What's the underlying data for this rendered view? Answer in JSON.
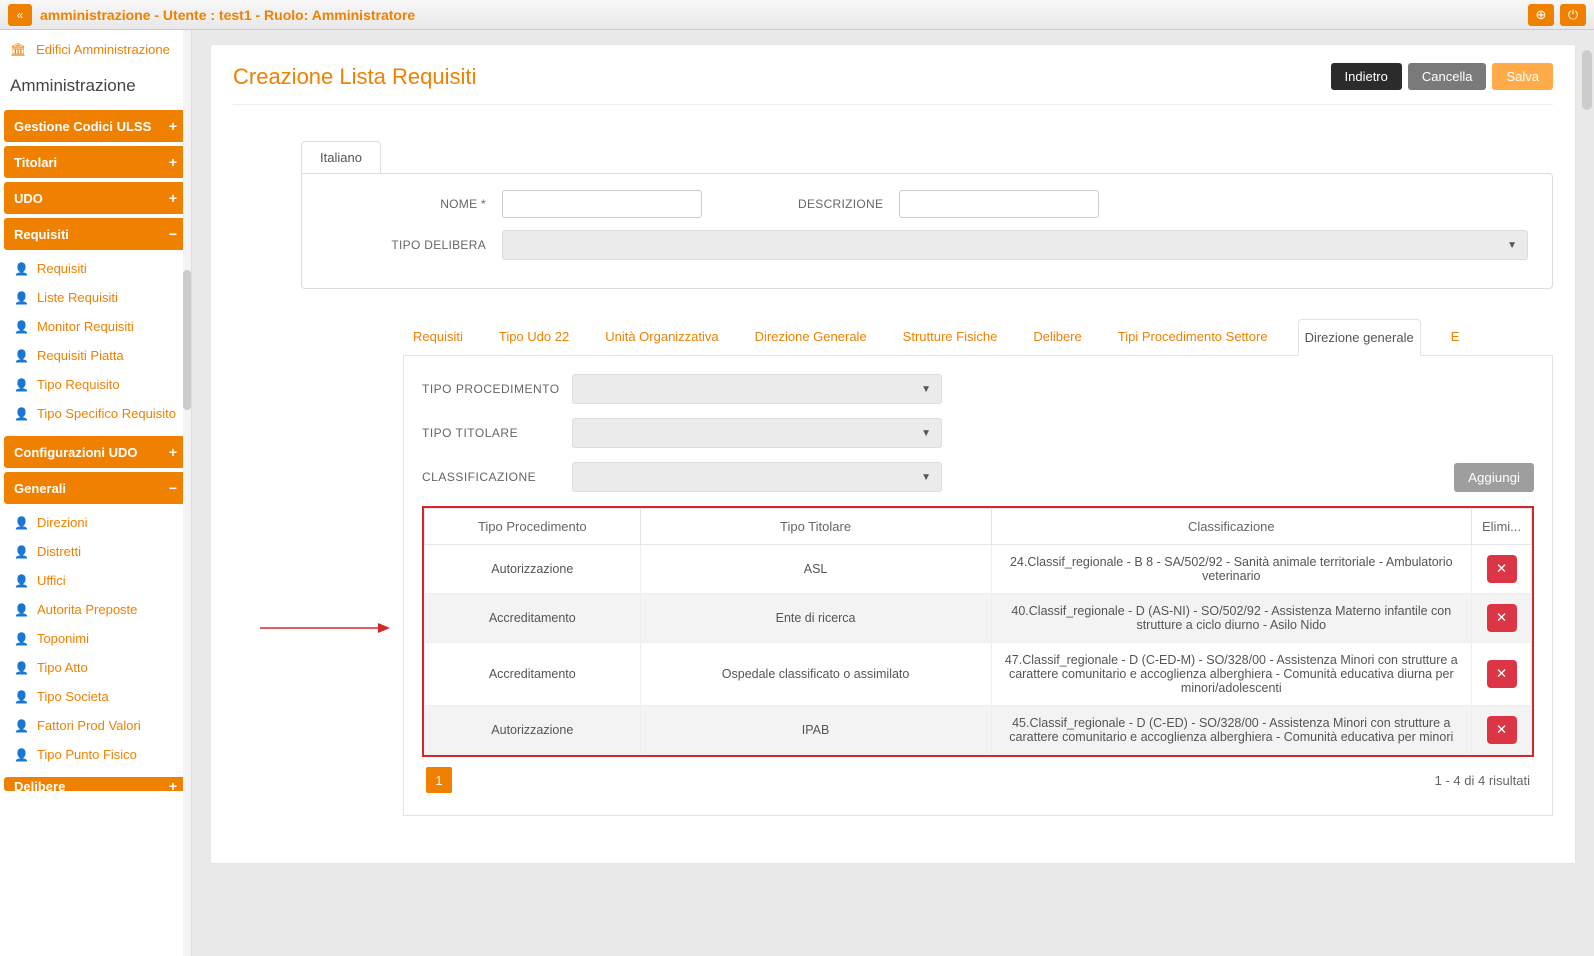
{
  "topbar": {
    "title": "amministrazione - Utente : test1 - Ruolo: Amministratore"
  },
  "sidebar": {
    "crumb": "Edifici Amministrazione",
    "section": "Amministrazione",
    "groups": [
      {
        "label": "Gestione Codici ULSS",
        "sym": "+"
      },
      {
        "label": "Titolari",
        "sym": "+"
      },
      {
        "label": "UDO",
        "sym": "+"
      },
      {
        "label": "Requisiti",
        "sym": "−",
        "items": [
          "Requisiti",
          "Liste Requisiti",
          "Monitor Requisiti",
          "Requisiti Piatta",
          "Tipo Requisito",
          "Tipo Specifico Requisito"
        ]
      },
      {
        "label": "Configurazioni UDO",
        "sym": "+"
      },
      {
        "label": "Generali",
        "sym": "−",
        "items": [
          "Direzioni",
          "Distretti",
          "Uffici",
          "Autorita Preposte",
          "Toponimi",
          "Tipo Atto",
          "Tipo Societa",
          "Fattori Prod Valori",
          "Tipo Punto Fisico"
        ]
      },
      {
        "label": "Delibere",
        "sym": "+",
        "cut": true
      }
    ]
  },
  "page": {
    "title": "Creazione Lista Requisiti",
    "buttons": {
      "back": "Indietro",
      "cancel": "Cancella",
      "save": "Salva"
    }
  },
  "form": {
    "lang": "Italiano",
    "name_label": "NOME *",
    "desc_label": "DESCRIZIONE",
    "tipo_delibera_label": "TIPO DELIBERA"
  },
  "tabs": [
    "Requisiti",
    "Tipo Udo 22",
    "Unità Organizzativa",
    "Direzione Generale",
    "Strutture Fisiche",
    "Delibere",
    "Tipi Procedimento Settore",
    "Direzione generale",
    "E"
  ],
  "active_tab": "Direzione generale",
  "filters": {
    "tipo_proc": "TIPO PROCEDIMENTO",
    "tipo_tit": "TIPO TITOLARE",
    "classif": "CLASSIFICAZIONE",
    "add": "Aggiungi"
  },
  "table": {
    "headers": [
      "Tipo Procedimento",
      "Tipo Titolare",
      "Classificazione",
      "Elimi..."
    ],
    "rows": [
      {
        "p": "Autorizzazione",
        "t": "ASL",
        "c": "24.Classif_regionale - B 8 - SA/502/92 - Sanità animale territoriale - Ambulatorio veterinario"
      },
      {
        "p": "Accreditamento",
        "t": "Ente di ricerca",
        "c": "40.Classif_regionale - D (AS-NI) - SO/502/92 - Assistenza Materno infantile con strutture a ciclo diurno - Asilo Nido"
      },
      {
        "p": "Accreditamento",
        "t": "Ospedale classificato o assimilato",
        "c": "47.Classif_regionale - D (C-ED-M) - SO/328/00 - Assistenza Minori con strutture a carattere comunitario e accoglienza alberghiera - Comunità educativa diurna per minori/adolescenti"
      },
      {
        "p": "Autorizzazione",
        "t": "IPAB",
        "c": "45.Classif_regionale - D (C-ED) - SO/328/00 - Assistenza Minori con strutture a carattere comunitario e accoglienza alberghiera - Comunità educativa per minori"
      }
    ]
  },
  "pager": {
    "page": "1",
    "info": "1 - 4 di 4 risultati"
  }
}
